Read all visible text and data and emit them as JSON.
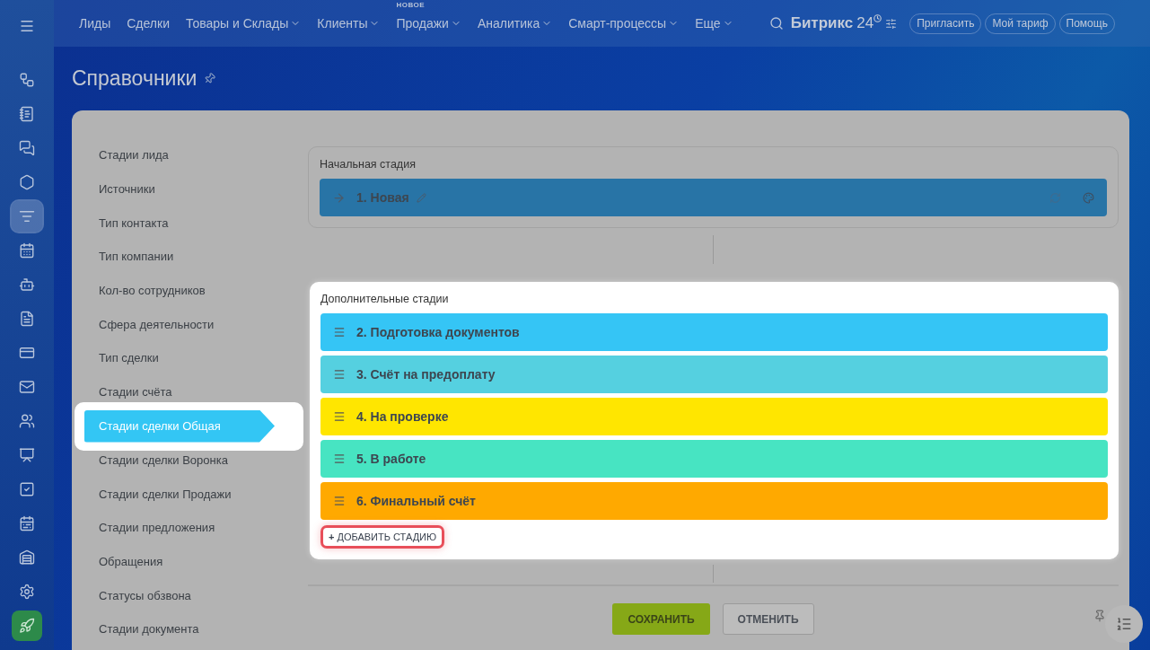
{
  "sidebar_icons": [
    {
      "kind": "menu",
      "selected": false
    },
    {
      "kind": "nodes",
      "selected": false
    },
    {
      "kind": "notes",
      "selected": false
    },
    {
      "kind": "chat",
      "selected": false
    },
    {
      "kind": "hexagon",
      "selected": false
    },
    {
      "kind": "funnel",
      "selected": true
    },
    {
      "kind": "calendar",
      "selected": false
    },
    {
      "kind": "robot",
      "selected": false
    },
    {
      "kind": "file",
      "selected": false
    },
    {
      "kind": "card",
      "selected": false
    },
    {
      "kind": "mail",
      "selected": false
    },
    {
      "kind": "users",
      "selected": false
    },
    {
      "kind": "board",
      "selected": false
    },
    {
      "kind": "check",
      "selected": false
    },
    {
      "kind": "schedule",
      "selected": false
    },
    {
      "kind": "store",
      "selected": false
    },
    {
      "kind": "settings",
      "selected": false
    },
    {
      "kind": "rocket",
      "selected": false
    }
  ],
  "top_nav": [
    {
      "label": "Лиды",
      "dropdown": false
    },
    {
      "label": "Сделки",
      "dropdown": false
    },
    {
      "label": "Товары и Склады",
      "dropdown": true
    },
    {
      "label": "Клиенты",
      "dropdown": true
    },
    {
      "label": "Продажи",
      "dropdown": true,
      "badge": "НОВОЕ"
    },
    {
      "label": "Аналитика",
      "dropdown": true
    },
    {
      "label": "Смарт-процессы",
      "dropdown": true
    },
    {
      "label": "Еще",
      "dropdown": true
    }
  ],
  "logo": {
    "name": "Битрикс",
    "number": "24"
  },
  "header_buttons": [
    "Пригласить",
    "Мой тариф",
    "Помощь"
  ],
  "page_title": "Справочники",
  "nav_items": [
    {
      "label": "Стадии лида",
      "selected": false
    },
    {
      "label": "Источники",
      "selected": false
    },
    {
      "label": "Тип контакта",
      "selected": false
    },
    {
      "label": "Тип компании",
      "selected": false
    },
    {
      "label": "Кол-во сотрудников",
      "selected": false
    },
    {
      "label": "Сфера деятельности",
      "selected": false
    },
    {
      "label": "Тип сделки",
      "selected": false
    },
    {
      "label": "Стадии счёта",
      "selected": false
    },
    {
      "label": "Стадии сделки Общая",
      "selected": true
    },
    {
      "label": "Стадии сделки Воронка",
      "selected": false
    },
    {
      "label": "Стадии сделки Продажи",
      "selected": false
    },
    {
      "label": "Стадии предложения",
      "selected": false
    },
    {
      "label": "Обращения",
      "selected": false
    },
    {
      "label": "Статусы обзвона",
      "selected": false
    },
    {
      "label": "Стадии документа",
      "selected": false
    }
  ],
  "initial_stage": {
    "heading": "Начальная стадия",
    "stage": {
      "label": "1. Новая",
      "color": "#2874a6"
    }
  },
  "extra_stages": {
    "heading": "Дополнительные стадии",
    "stages": [
      {
        "label": "2. Подготовка документов",
        "color": "#35c5f5"
      },
      {
        "label": "3. Счёт на предоплату",
        "color": "#55d0e0"
      },
      {
        "label": "4. На проверке",
        "color": "#ffe600"
      },
      {
        "label": "5. В работе",
        "color": "#47e4c2"
      },
      {
        "label": "6. Финальный счёт",
        "color": "#ffa900"
      }
    ],
    "add_button": "**+** ДОБАВИТЬ СТАДИЮ"
  },
  "footer": {
    "save": "СОХРАНИТЬ",
    "cancel": "ОТМЕНИТЬ"
  }
}
